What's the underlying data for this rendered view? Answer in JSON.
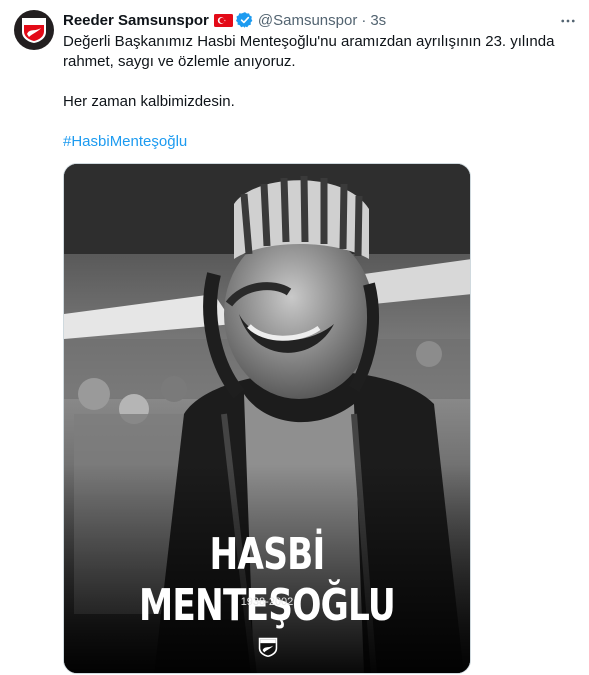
{
  "tweet": {
    "author": {
      "name": "Reeder Samsunspor",
      "handle": "@Samsunspor",
      "time": "3s",
      "separator": "·",
      "avatar_icon": "samsunspor-crest-icon",
      "flag_icon": "turkey-flag-icon",
      "verified_icon": "verified-badge-icon"
    },
    "text": {
      "line1": "Değerli Başkanımız Hasbi Menteşoğlu'nu aramızdan ayrılışının 23. yılında rahmet, saygı ve özlemle anıyoruz.",
      "line2": "Her zaman kalbimizdesin.",
      "hashtag": "#HasbiMenteşoğlu"
    },
    "media": {
      "title": "HASBİ MENTEŞOĞLU",
      "years": "1938-2002",
      "logo_icon": "samsunspor-crest-icon"
    }
  },
  "colors": {
    "link": "#1d9bf0",
    "text": "#0f1419",
    "muted": "#536471",
    "verified": "#1d9bf0",
    "flag": "#e30a17"
  }
}
